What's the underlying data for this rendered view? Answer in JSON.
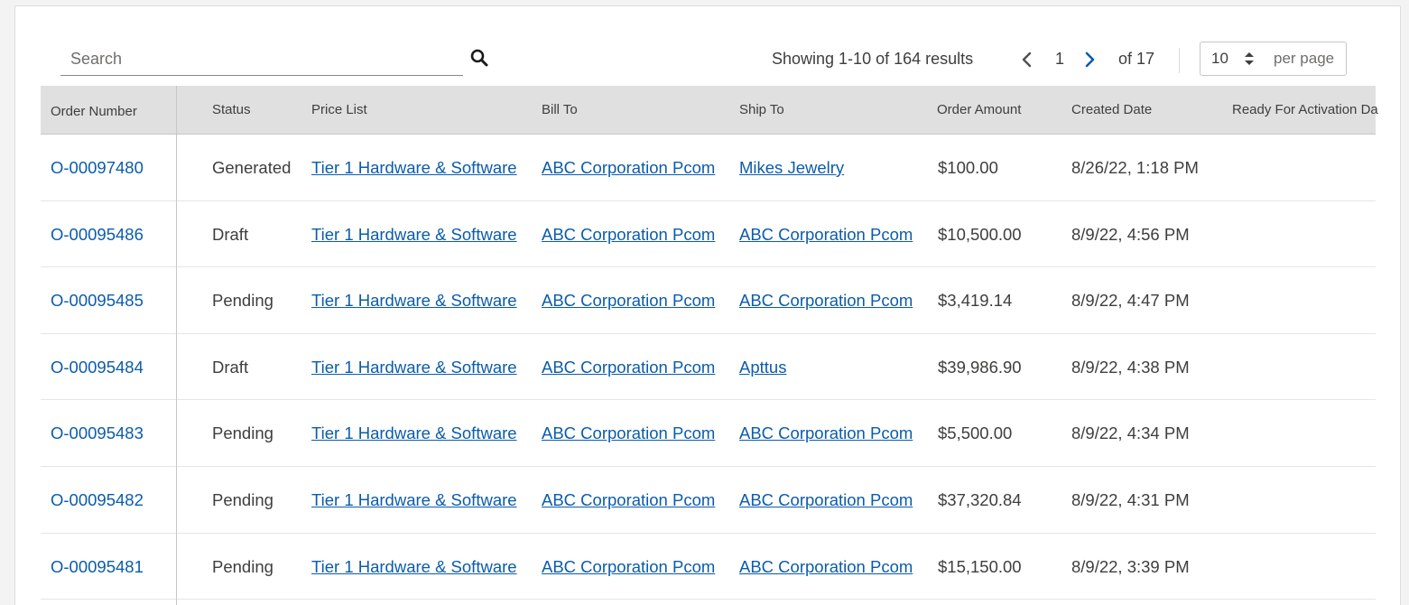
{
  "search": {
    "placeholder": "Search"
  },
  "pagination": {
    "results_text": "Showing 1-10 of 164 results",
    "current_page": "1",
    "of_text": "of 17",
    "per_page_value": "10",
    "per_page_label": "per page"
  },
  "table": {
    "columns": [
      "Order Number",
      "Status",
      "Price List",
      "Bill To",
      "Ship To",
      "Order Amount",
      "Created Date",
      "Ready For Activation Da"
    ],
    "rows": [
      {
        "order_number": "O-00097480",
        "status": "Generated",
        "price_list": "Tier 1 Hardware & Software",
        "bill_to": "ABC Corporation Pcom",
        "ship_to": "Mikes Jewelry",
        "order_amount": "$100.00",
        "created_date": "8/26/22, 1:18 PM"
      },
      {
        "order_number": "O-00095486",
        "status": "Draft",
        "price_list": "Tier 1 Hardware & Software",
        "bill_to": "ABC Corporation Pcom",
        "ship_to": "ABC Corporation Pcom",
        "order_amount": "$10,500.00",
        "created_date": "8/9/22, 4:56 PM"
      },
      {
        "order_number": "O-00095485",
        "status": "Pending",
        "price_list": "Tier 1 Hardware & Software",
        "bill_to": "ABC Corporation Pcom",
        "ship_to": "ABC Corporation Pcom",
        "order_amount": "$3,419.14",
        "created_date": "8/9/22, 4:47 PM"
      },
      {
        "order_number": "O-00095484",
        "status": "Draft",
        "price_list": "Tier 1 Hardware & Software",
        "bill_to": "ABC Corporation Pcom",
        "ship_to": "Apttus",
        "order_amount": "$39,986.90",
        "created_date": "8/9/22, 4:38 PM"
      },
      {
        "order_number": "O-00095483",
        "status": "Pending",
        "price_list": "Tier 1 Hardware & Software",
        "bill_to": "ABC Corporation Pcom",
        "ship_to": "ABC Corporation Pcom",
        "order_amount": "$5,500.00",
        "created_date": "8/9/22, 4:34 PM"
      },
      {
        "order_number": "O-00095482",
        "status": "Pending",
        "price_list": "Tier 1 Hardware & Software",
        "bill_to": "ABC Corporation Pcom",
        "ship_to": "ABC Corporation Pcom",
        "order_amount": "$37,320.84",
        "created_date": "8/9/22, 4:31 PM"
      },
      {
        "order_number": "O-00095481",
        "status": "Pending",
        "price_list": "Tier 1 Hardware & Software",
        "bill_to": "ABC Corporation Pcom",
        "ship_to": "ABC Corporation Pcom",
        "order_amount": "$15,150.00",
        "created_date": "8/9/22, 3:39 PM"
      }
    ]
  },
  "icons": {
    "search": "search-icon",
    "prev": "chevron-left-icon",
    "next": "chevron-right-icon",
    "select": "sort-arrows-icon"
  },
  "colors": {
    "link": "#0b5cab",
    "header_bg": "#e0e0e0",
    "next_arrow": "#0b5cab",
    "prev_arrow": "#514f4d"
  }
}
